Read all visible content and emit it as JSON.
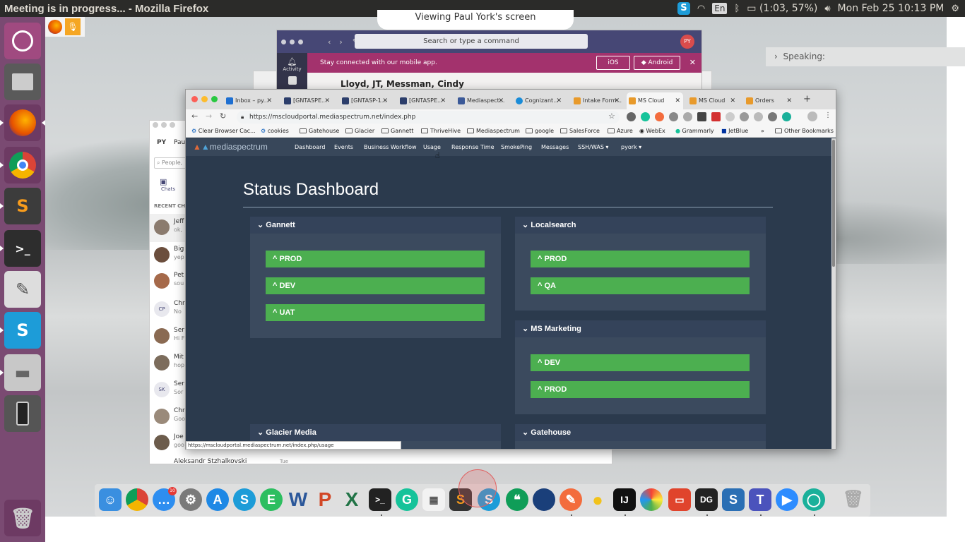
{
  "topbar": {
    "window_title": "Meeting is in progress... - Mozilla Firefox",
    "battery": "(1:03, 57%)",
    "lang": "En",
    "clock": "Mon Feb 25 10:13 PM"
  },
  "screenshare": {
    "viewing_text": "Viewing Paul York's screen",
    "speaking_label": "Speaking:"
  },
  "teams": {
    "search_placeholder": "Search or type a command",
    "avatar_initials": "PY",
    "rail_label": "Activity",
    "banner_text": "Stay connected with our mobile app.",
    "ios_label": "iOS",
    "android_label": "Android",
    "participants": "Lloyd, JT,  Messman, Cindy"
  },
  "chat": {
    "user_initials": "PY",
    "user_name": "Paul",
    "search_placeholder": "People,",
    "chats_label": "Chats",
    "recent_label": "RECENT CHA",
    "rows": [
      {
        "name": "Jeff",
        "sub": "ok,"
      },
      {
        "name": "Big",
        "sub": "yep"
      },
      {
        "name": "Pet",
        "sub": "sou"
      },
      {
        "name": "Chr",
        "sub": "No"
      },
      {
        "name": "Ser",
        "sub": "Hi F"
      },
      {
        "name": "Mit",
        "sub": "hop"
      },
      {
        "name": "Ser",
        "sub": "Sor"
      },
      {
        "name": "Chr",
        "sub": "Goo"
      },
      {
        "name": "Joe",
        "sub": "goo"
      }
    ],
    "cp_initials": "CP",
    "sk_initials": "SK",
    "last_name": "Aleksandr Stzhalkovski",
    "last_time": "Tue"
  },
  "browser": {
    "tabs": [
      {
        "label": "Inbox – py..."
      },
      {
        "label": "[GNTASPE..."
      },
      {
        "label": "[GNTASP-1..."
      },
      {
        "label": "[GNTASPE..."
      },
      {
        "label": "Mediaspect..."
      },
      {
        "label": "Cognizant..."
      },
      {
        "label": "Intake Form..."
      },
      {
        "label": "MS Cloud"
      },
      {
        "label": "MS Cloud"
      },
      {
        "label": "Orders"
      }
    ],
    "url": "https://mscloudportal.mediaspectrum.net/index.php",
    "bookmarks": [
      "Clear Browser Cac...",
      "cookies",
      "Gatehouse",
      "Glacier",
      "Gannett",
      "ThriveHive",
      "Mediaspectrum",
      "google",
      "SalesForce",
      "Azure",
      "WebEx",
      "Grammarly",
      "JetBlue",
      "»",
      "Other Bookmarks"
    ],
    "status_url": "https://mscloudportal.mediaspectrum.net/index.php/usage"
  },
  "site": {
    "logo": "mediaspectrum",
    "nav": [
      "Dashboard",
      "Events",
      "Business Workflow",
      "Usage",
      "Response Time",
      "SmokePing",
      "Messages",
      "SSH/WAS ▾",
      "pyork ▾"
    ],
    "title": "Status Dashboard",
    "panels": {
      "gannett": {
        "title": "Gannett",
        "envs": [
          "PROD",
          "DEV",
          "UAT"
        ]
      },
      "localsearch": {
        "title": "Localsearch",
        "envs": [
          "PROD",
          "QA"
        ]
      },
      "msmarketing": {
        "title": "MS Marketing",
        "envs": [
          "DEV",
          "PROD"
        ]
      },
      "glacier": {
        "title": "Glacier Media"
      },
      "gatehouse": {
        "title": "Gatehouse"
      }
    }
  },
  "colors": {
    "status_up": "#4caf50",
    "page_bg": "#2b3a4d",
    "launcher": "#7a4a72"
  }
}
